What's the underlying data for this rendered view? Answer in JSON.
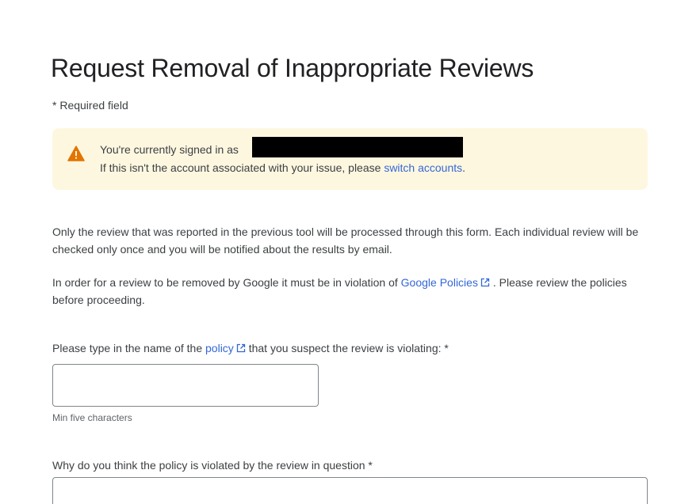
{
  "page": {
    "title": "Request Removal of Inappropriate Reviews",
    "required_note": "* Required field"
  },
  "notice": {
    "icon": "warning-icon",
    "icon_color": "#e37400",
    "background_color": "#fef7e0",
    "signed_in_text": "You're currently signed in as",
    "switch_prefix": "If this isn't the account associated with your issue, please ",
    "switch_link": "switch accounts",
    "switch_suffix": "."
  },
  "intro": {
    "paragraph1": "Only the review that was reported in the previous tool will be processed through this form. Each individual review will be checked only once and you will be notified about the results by email.",
    "paragraph2_prefix": "In order for a review to be removed by Google it must be in violation of ",
    "paragraph2_link": "Google Policies",
    "paragraph2_suffix": " . Please review the policies before proceeding."
  },
  "form": {
    "policy_field": {
      "label_prefix": "Please type in the name of the ",
      "label_link": "policy",
      "label_suffix": "  that you suspect the review is violating: *",
      "value": "",
      "helper": "Min five characters"
    },
    "reason_field": {
      "label": "Why do you think the policy is violated by the review in question *",
      "value": ""
    }
  },
  "colors": {
    "link": "#3367d6",
    "text": "#3c4043",
    "title": "#202124"
  }
}
